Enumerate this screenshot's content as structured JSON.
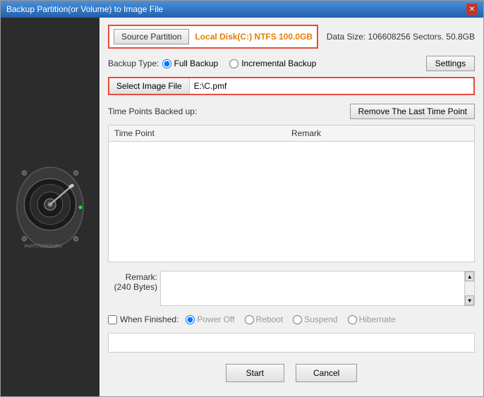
{
  "window": {
    "title": "Backup Partition(or Volume) to Image File",
    "close_label": "✕"
  },
  "header": {
    "source_partition_label": "Source Partition",
    "source_partition_value": "Local Disk(C:) NTFS 100.0GB",
    "data_size_label": "Data Size: 106608256 Sectors. 50.8GB"
  },
  "backup_type": {
    "label": "Backup Type:",
    "options": [
      "Full Backup",
      "Incremental Backup"
    ],
    "selected": "Full Backup",
    "settings_label": "Settings"
  },
  "select_image": {
    "button_label": "Select Image File",
    "path_value": "E:\\C.pmf"
  },
  "time_points": {
    "label": "Time Points Backed up:",
    "remove_btn_label": "Remove The Last Time Point",
    "columns": [
      "Time Point",
      "Remark"
    ]
  },
  "remark": {
    "label": "Remark:",
    "size_label": "(240 Bytes)"
  },
  "when_finished": {
    "checkbox_label": "When Finished:",
    "options": [
      "Power Off",
      "Reboot",
      "Suspend",
      "Hibernate"
    ],
    "selected": "Power Off"
  },
  "buttons": {
    "start_label": "Start",
    "cancel_label": "Cancel"
  }
}
